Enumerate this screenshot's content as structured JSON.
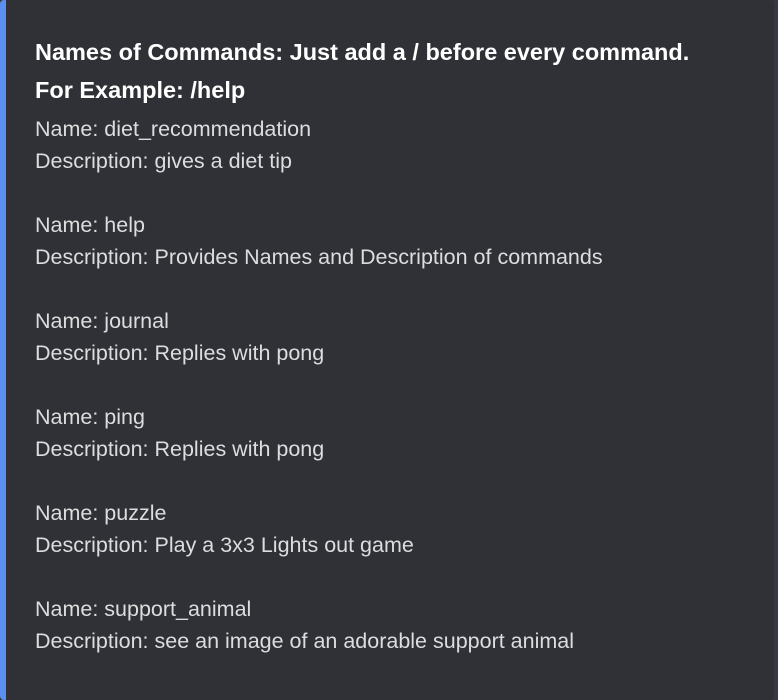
{
  "embed": {
    "accent_color": "#5b8ff0",
    "background_color": "#2f3136",
    "title_line_1": "Names of Commands: Just add a / before every command.",
    "title_line_2": "For Example: /help"
  },
  "commands": [
    {
      "name_line": "Name: diet_recommendation",
      "description_line": "Description: gives a diet tip"
    },
    {
      "name_line": "Name: help",
      "description_line": "Description: Provides Names and Description of commands"
    },
    {
      "name_line": "Name: journal",
      "description_line": "Description: Replies with pong"
    },
    {
      "name_line": "Name: ping",
      "description_line": "Description: Replies with pong"
    },
    {
      "name_line": "Name: puzzle",
      "description_line": "Description: Play a 3x3 Lights out game"
    },
    {
      "name_line": "Name: support_animal",
      "description_line": "Description: see an image of an adorable support animal"
    }
  ]
}
